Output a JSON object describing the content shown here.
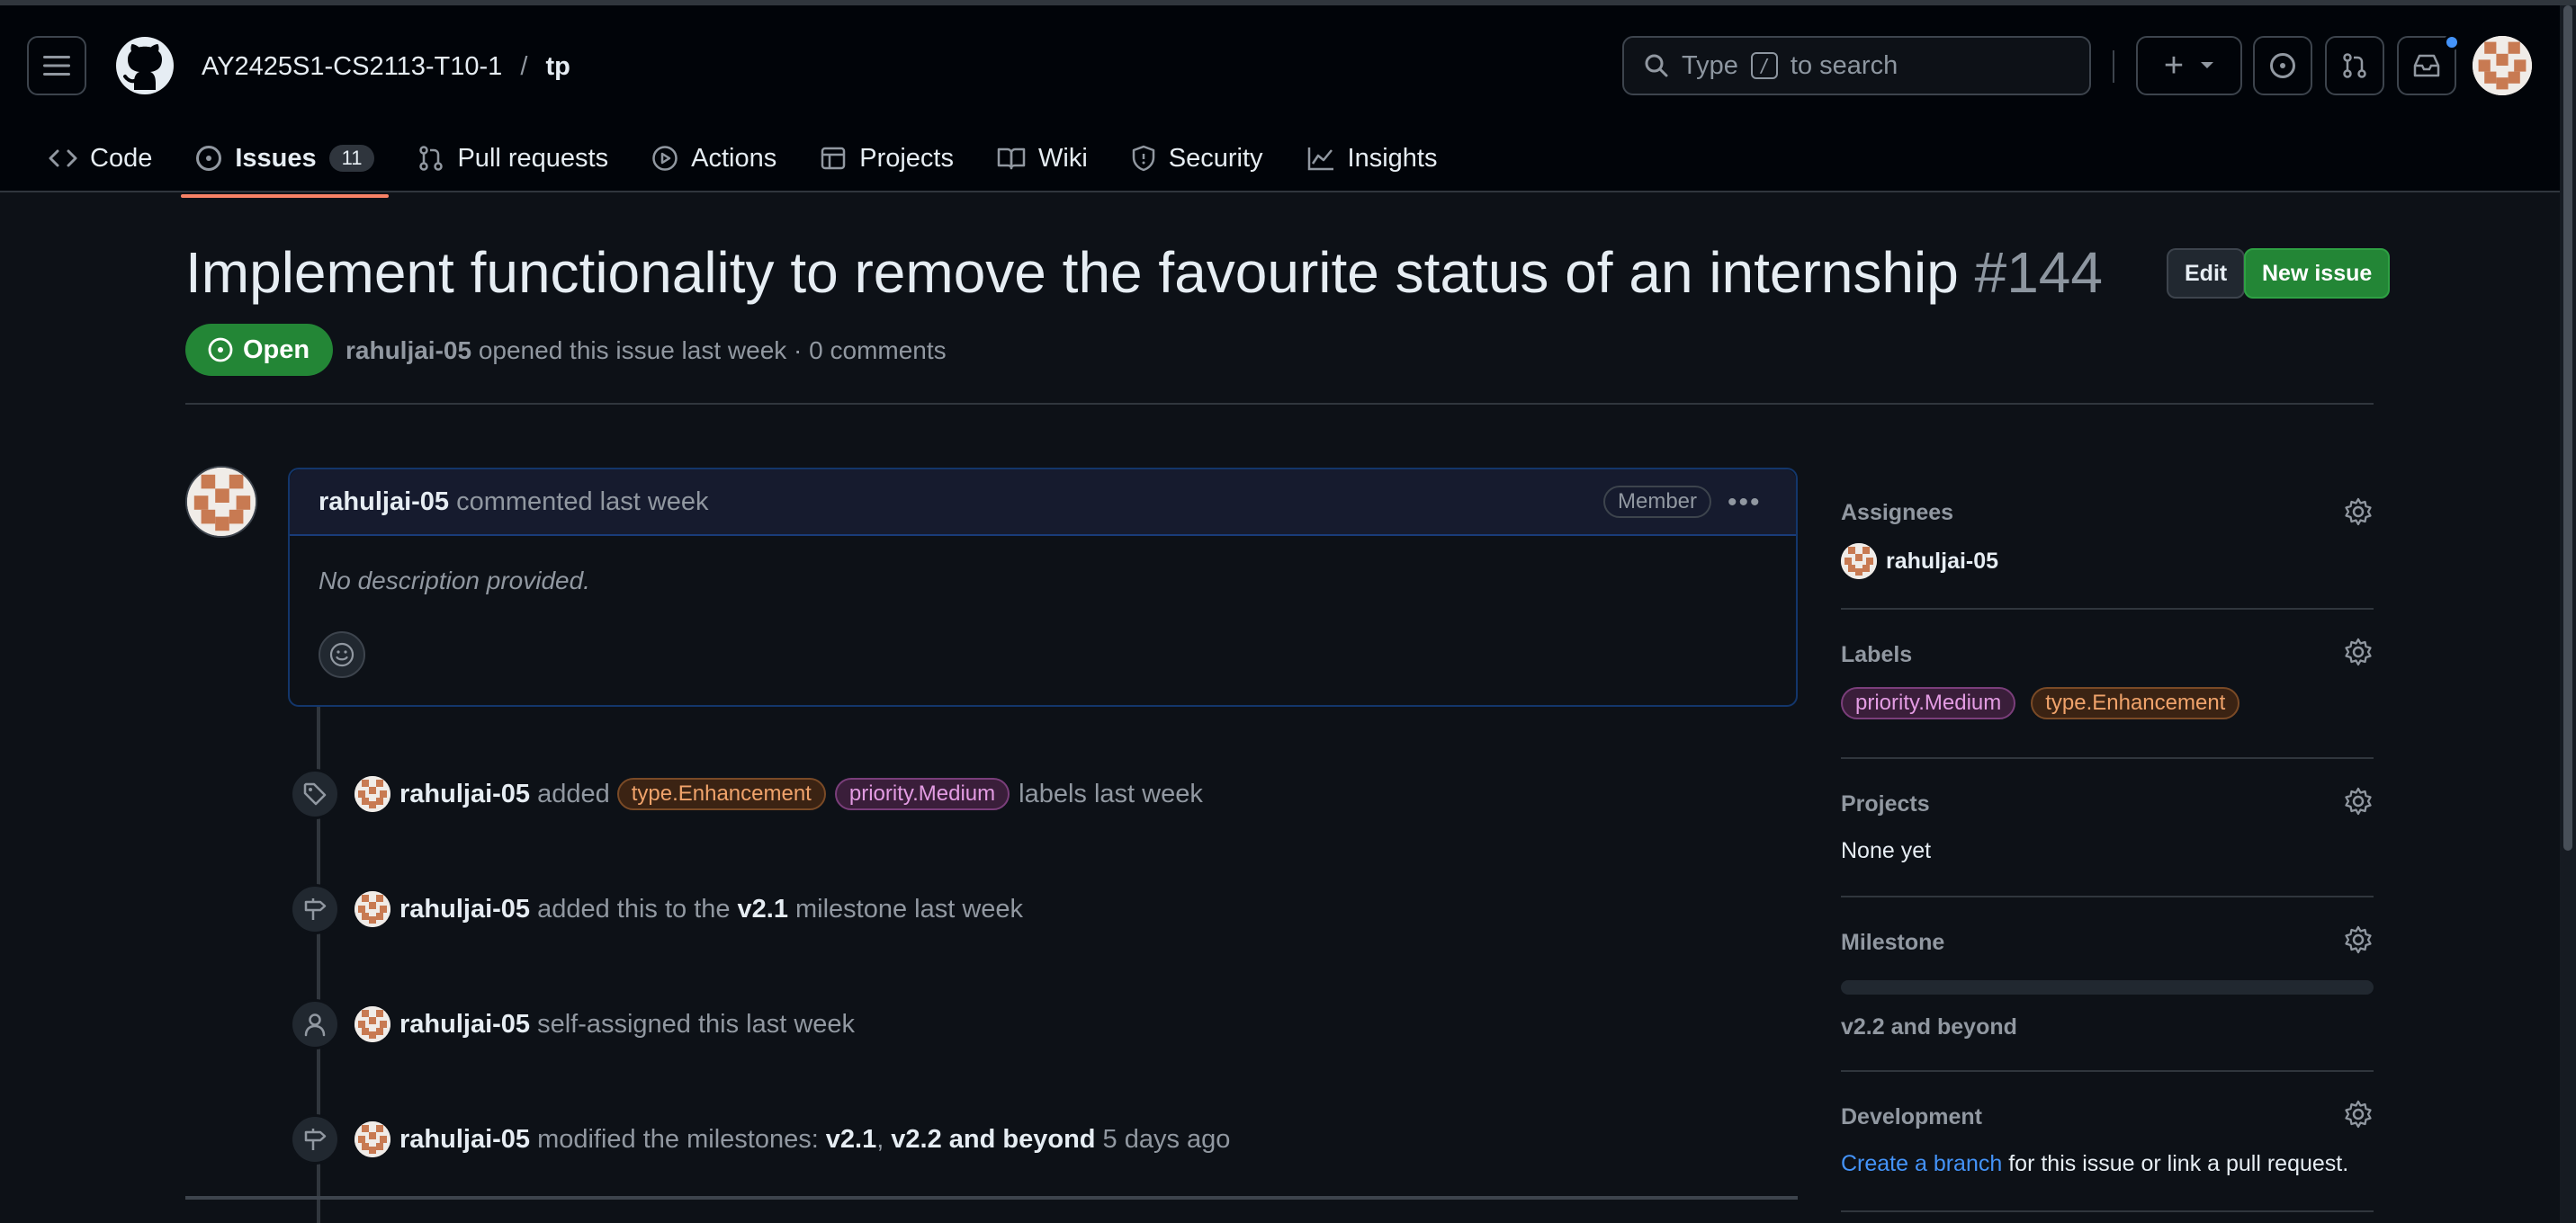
{
  "header": {
    "owner": "AY2425S1-CS2113-T10-1",
    "separator": "/",
    "repo": "tp",
    "search_prefix": "Type",
    "search_key": "/",
    "search_suffix": "to search",
    "create_label": "+"
  },
  "tabs": [
    {
      "label": "Code",
      "icon": "code-icon"
    },
    {
      "label": "Issues",
      "icon": "issue-icon",
      "count": "11",
      "active": true
    },
    {
      "label": "Pull requests",
      "icon": "pull-request-icon"
    },
    {
      "label": "Actions",
      "icon": "play-icon"
    },
    {
      "label": "Projects",
      "icon": "table-icon"
    },
    {
      "label": "Wiki",
      "icon": "book-icon"
    },
    {
      "label": "Security",
      "icon": "shield-icon"
    },
    {
      "label": "Insights",
      "icon": "graph-icon"
    }
  ],
  "issue": {
    "title": "Implement functionality to remove the favourite status of an internship",
    "number": "#144",
    "edit_label": "Edit",
    "new_issue_label": "New issue",
    "state": "Open",
    "author": "rahuljai-05",
    "opened_text": "opened this issue last week · 0 comments"
  },
  "comment": {
    "author": "rahuljai-05",
    "action": "commented last week",
    "role": "Member",
    "body": "No description provided."
  },
  "events": {
    "labels": {
      "actor": "rahuljai-05",
      "verb": "added",
      "label1": "type.Enhancement",
      "label2": "priority.Medium",
      "tail": "labels last week"
    },
    "milestone": {
      "actor": "rahuljai-05",
      "pre": "added this to the",
      "name": "v2.1",
      "tail": "milestone last week"
    },
    "assign": {
      "actor": "rahuljai-05",
      "text": "self-assigned this last week"
    },
    "modify": {
      "actor": "rahuljai-05",
      "pre": "modified the milestones:",
      "m1": "v2.1",
      "comma": ",",
      "m2": "v2.2 and beyond",
      "tail": "5 days ago"
    }
  },
  "sidebar": {
    "assignees_label": "Assignees",
    "assignee": "rahuljai-05",
    "labels_label": "Labels",
    "label1": "priority.Medium",
    "label2": "type.Enhancement",
    "projects_label": "Projects",
    "projects_value": "None yet",
    "milestone_label": "Milestone",
    "milestone_progress": 0,
    "milestone_value": "v2.2 and beyond",
    "development_label": "Development",
    "dev_link": "Create a branch",
    "dev_text": "for this issue or link a pull request."
  },
  "colors": {
    "background": "#0d1117",
    "open_state": "#238636",
    "accent_link": "#4493f8",
    "active_tab_underline": "#f78166"
  }
}
